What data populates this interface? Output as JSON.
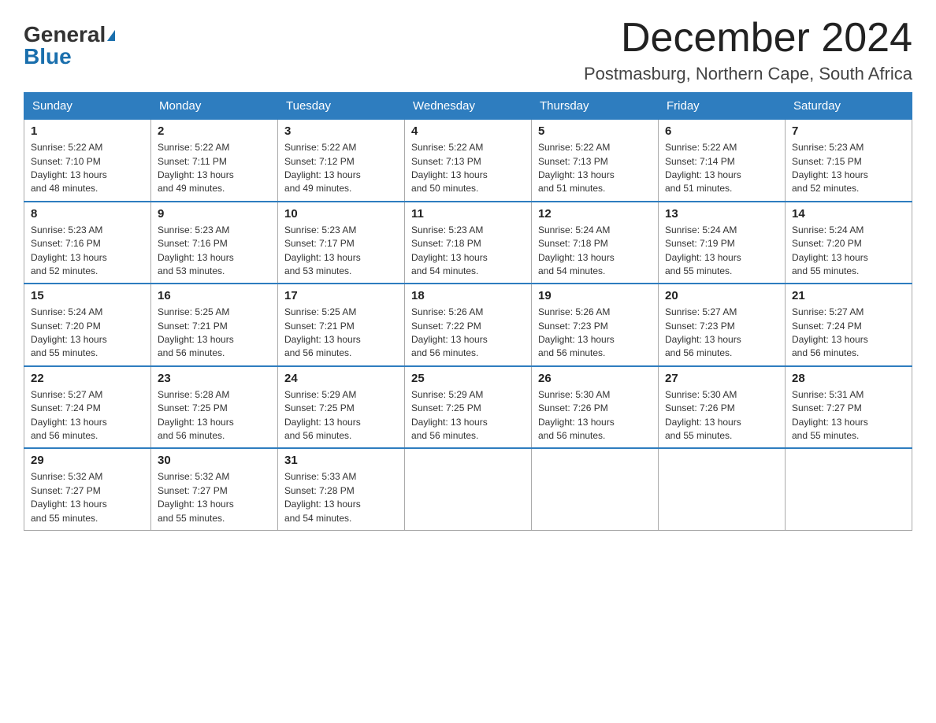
{
  "logo": {
    "general": "General",
    "blue": "Blue"
  },
  "title": "December 2024",
  "location": "Postmasburg, Northern Cape, South Africa",
  "weekdays": [
    "Sunday",
    "Monday",
    "Tuesday",
    "Wednesday",
    "Thursday",
    "Friday",
    "Saturday"
  ],
  "weeks": [
    [
      {
        "day": "1",
        "sunrise": "5:22 AM",
        "sunset": "7:10 PM",
        "daylight": "13 hours and 48 minutes."
      },
      {
        "day": "2",
        "sunrise": "5:22 AM",
        "sunset": "7:11 PM",
        "daylight": "13 hours and 49 minutes."
      },
      {
        "day": "3",
        "sunrise": "5:22 AM",
        "sunset": "7:12 PM",
        "daylight": "13 hours and 49 minutes."
      },
      {
        "day": "4",
        "sunrise": "5:22 AM",
        "sunset": "7:13 PM",
        "daylight": "13 hours and 50 minutes."
      },
      {
        "day": "5",
        "sunrise": "5:22 AM",
        "sunset": "7:13 PM",
        "daylight": "13 hours and 51 minutes."
      },
      {
        "day": "6",
        "sunrise": "5:22 AM",
        "sunset": "7:14 PM",
        "daylight": "13 hours and 51 minutes."
      },
      {
        "day": "7",
        "sunrise": "5:23 AM",
        "sunset": "7:15 PM",
        "daylight": "13 hours and 52 minutes."
      }
    ],
    [
      {
        "day": "8",
        "sunrise": "5:23 AM",
        "sunset": "7:16 PM",
        "daylight": "13 hours and 52 minutes."
      },
      {
        "day": "9",
        "sunrise": "5:23 AM",
        "sunset": "7:16 PM",
        "daylight": "13 hours and 53 minutes."
      },
      {
        "day": "10",
        "sunrise": "5:23 AM",
        "sunset": "7:17 PM",
        "daylight": "13 hours and 53 minutes."
      },
      {
        "day": "11",
        "sunrise": "5:23 AM",
        "sunset": "7:18 PM",
        "daylight": "13 hours and 54 minutes."
      },
      {
        "day": "12",
        "sunrise": "5:24 AM",
        "sunset": "7:18 PM",
        "daylight": "13 hours and 54 minutes."
      },
      {
        "day": "13",
        "sunrise": "5:24 AM",
        "sunset": "7:19 PM",
        "daylight": "13 hours and 55 minutes."
      },
      {
        "day": "14",
        "sunrise": "5:24 AM",
        "sunset": "7:20 PM",
        "daylight": "13 hours and 55 minutes."
      }
    ],
    [
      {
        "day": "15",
        "sunrise": "5:24 AM",
        "sunset": "7:20 PM",
        "daylight": "13 hours and 55 minutes."
      },
      {
        "day": "16",
        "sunrise": "5:25 AM",
        "sunset": "7:21 PM",
        "daylight": "13 hours and 56 minutes."
      },
      {
        "day": "17",
        "sunrise": "5:25 AM",
        "sunset": "7:21 PM",
        "daylight": "13 hours and 56 minutes."
      },
      {
        "day": "18",
        "sunrise": "5:26 AM",
        "sunset": "7:22 PM",
        "daylight": "13 hours and 56 minutes."
      },
      {
        "day": "19",
        "sunrise": "5:26 AM",
        "sunset": "7:23 PM",
        "daylight": "13 hours and 56 minutes."
      },
      {
        "day": "20",
        "sunrise": "5:27 AM",
        "sunset": "7:23 PM",
        "daylight": "13 hours and 56 minutes."
      },
      {
        "day": "21",
        "sunrise": "5:27 AM",
        "sunset": "7:24 PM",
        "daylight": "13 hours and 56 minutes."
      }
    ],
    [
      {
        "day": "22",
        "sunrise": "5:27 AM",
        "sunset": "7:24 PM",
        "daylight": "13 hours and 56 minutes."
      },
      {
        "day": "23",
        "sunrise": "5:28 AM",
        "sunset": "7:25 PM",
        "daylight": "13 hours and 56 minutes."
      },
      {
        "day": "24",
        "sunrise": "5:29 AM",
        "sunset": "7:25 PM",
        "daylight": "13 hours and 56 minutes."
      },
      {
        "day": "25",
        "sunrise": "5:29 AM",
        "sunset": "7:25 PM",
        "daylight": "13 hours and 56 minutes."
      },
      {
        "day": "26",
        "sunrise": "5:30 AM",
        "sunset": "7:26 PM",
        "daylight": "13 hours and 56 minutes."
      },
      {
        "day": "27",
        "sunrise": "5:30 AM",
        "sunset": "7:26 PM",
        "daylight": "13 hours and 55 minutes."
      },
      {
        "day": "28",
        "sunrise": "5:31 AM",
        "sunset": "7:27 PM",
        "daylight": "13 hours and 55 minutes."
      }
    ],
    [
      {
        "day": "29",
        "sunrise": "5:32 AM",
        "sunset": "7:27 PM",
        "daylight": "13 hours and 55 minutes."
      },
      {
        "day": "30",
        "sunrise": "5:32 AM",
        "sunset": "7:27 PM",
        "daylight": "13 hours and 55 minutes."
      },
      {
        "day": "31",
        "sunrise": "5:33 AM",
        "sunset": "7:28 PM",
        "daylight": "13 hours and 54 minutes."
      },
      null,
      null,
      null,
      null
    ]
  ],
  "labels": {
    "sunrise": "Sunrise:",
    "sunset": "Sunset:",
    "daylight": "Daylight:"
  }
}
